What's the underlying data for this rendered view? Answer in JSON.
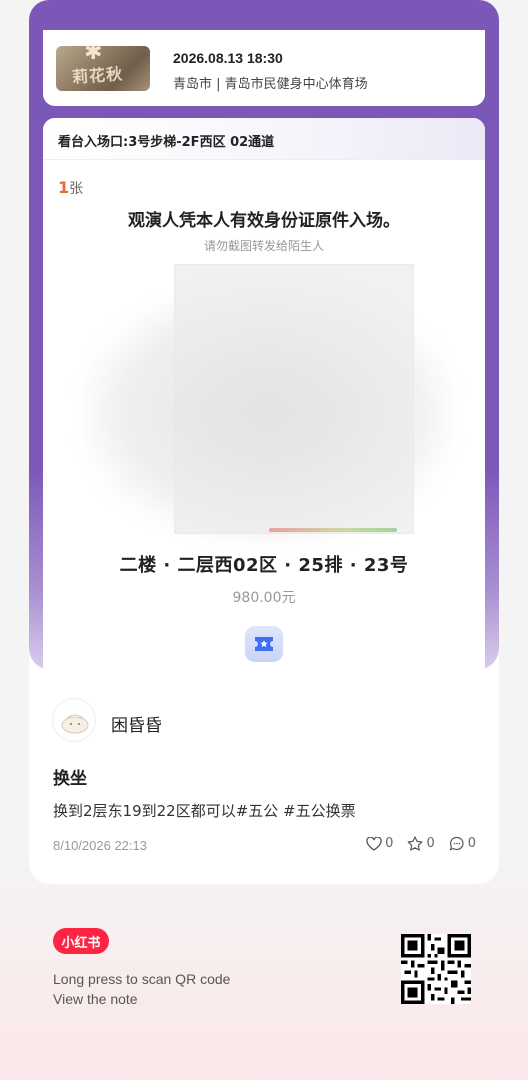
{
  "event": {
    "poster_title": "莉花秋",
    "datetime": "2026.08.13 18:30",
    "venue": "青岛市 | 青岛市民健身中心体育场"
  },
  "ticket": {
    "entrance": "看台入场口:3号步梯-2F西区 02通道",
    "count_number": "1",
    "count_unit": "张",
    "notice": "观演人凭本人有效身份证原件入场。",
    "warning": "请勿截图转发给陌生人",
    "seat": "二楼 · 二层西02区 · 25排 · 23号",
    "price": "980.00元"
  },
  "post": {
    "username": "困昏昏",
    "title": "换坐",
    "body": "换到2层东19到22区都可以#五公 #五公换票",
    "time": "8/10/2026 22:13",
    "likes": "0",
    "favorites": "0",
    "comments": "0"
  },
  "footer": {
    "logo": "小红书",
    "scan_line1": "Long press to scan QR code",
    "scan_line2": "View the note"
  },
  "colors": {
    "ticket_purple": "#7b57b8",
    "brand_red": "#ff2442",
    "count_orange": "#e9683b"
  },
  "icons": [
    "ticket-icon",
    "heart-icon",
    "star-icon",
    "comment-icon",
    "qr-code"
  ]
}
